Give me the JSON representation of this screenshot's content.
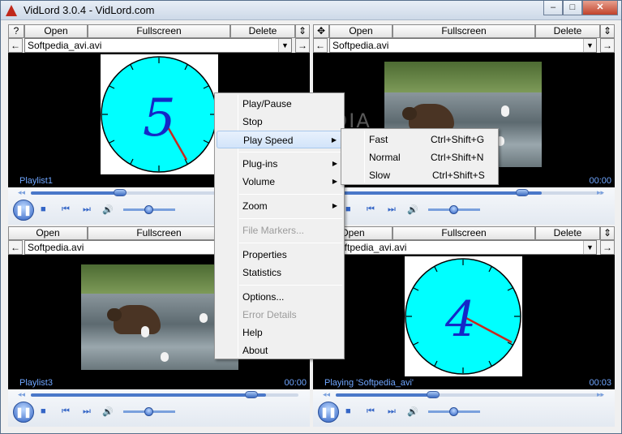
{
  "window": {
    "title": "VidLord 3.0.4 - VidLord.com",
    "minimize": "–",
    "maximize": "□",
    "close": "✕"
  },
  "toolbar": {
    "help": "?",
    "move": "✥",
    "open": "Open",
    "fullscreen": "Fullscreen",
    "delete": "Delete",
    "updown": "⇕",
    "back": "←",
    "forward": "→"
  },
  "panes": [
    {
      "file": "Softpedia_avi.avi",
      "label_left": "Playlist1",
      "label_right": "",
      "clock_digit": "5",
      "seek": 0.28
    },
    {
      "file": "Softpedia.avi",
      "label_left": "",
      "label_right": "00:00",
      "seek": 0.86
    },
    {
      "file": "Softpedia.avi",
      "label_left": "Playlist3",
      "label_right": "00:00",
      "seek": 0.86
    },
    {
      "file": "Softpedia_avi.avi",
      "label_left": "Playing 'Softpedia_avi'",
      "label_right": "00:03",
      "clock_digit": "4",
      "seek": 0.34
    }
  ],
  "context_menu": {
    "items": [
      "Play/Pause",
      "Stop",
      "Play Speed",
      "Plug-ins",
      "Volume",
      "Zoom",
      "File Markers...",
      "Properties",
      "Statistics",
      "Options...",
      "Error Details",
      "Help",
      "About"
    ],
    "highlighted": "Play Speed",
    "disabled": [
      "File Markers...",
      "Error Details"
    ]
  },
  "speed_submenu": {
    "items": [
      {
        "label": "Fast",
        "shortcut": "Ctrl+Shift+G"
      },
      {
        "label": "Normal",
        "shortcut": "Ctrl+Shift+N"
      },
      {
        "label": "Slow",
        "shortcut": "Ctrl+Shift+S"
      }
    ]
  },
  "watermark": "SOFTPEDIA",
  "colors": {
    "clock_face": "#00ffff",
    "digit": "#1428c8",
    "hand": "#c8281e",
    "accent": "#3465c6"
  }
}
